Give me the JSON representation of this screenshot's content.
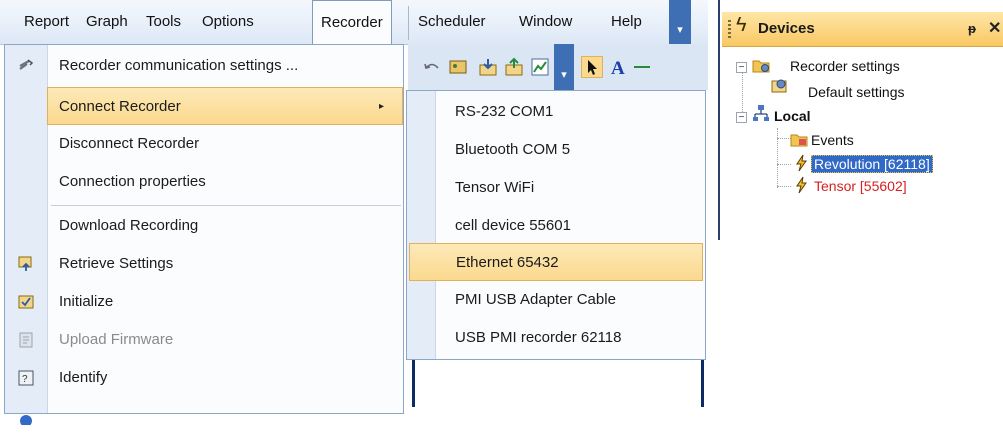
{
  "menubar": {
    "items": [
      "Report",
      "Graph",
      "Tools",
      "Options",
      "Recorder",
      "Scheduler",
      "Window",
      "Help"
    ]
  },
  "recorder_menu": {
    "items": [
      {
        "label": "Recorder communication settings ...",
        "icon": "wrench-icon"
      },
      {
        "label": "Connect Recorder",
        "icon": "",
        "submenu": true,
        "highlighted": true
      },
      {
        "label": "Disconnect Recorder",
        "icon": ""
      },
      {
        "label": "Connection properties",
        "icon": ""
      },
      {
        "label": "Download Recording",
        "icon": ""
      },
      {
        "label": "Retrieve Settings",
        "icon": "retrieve-icon"
      },
      {
        "label": "Initialize",
        "icon": "initialize-icon"
      },
      {
        "label": "Upload Firmware",
        "icon": "upload-icon",
        "disabled": true
      },
      {
        "label": "Identify",
        "icon": "identify-icon"
      }
    ],
    "submenu_arrow": "▸"
  },
  "connect_submenu": {
    "items": [
      "RS-232 COM1",
      "Bluetooth COM 5",
      "Tensor WiFi",
      "cell device 55601",
      "Ethernet 65432",
      "PMI USB Adapter Cable",
      "USB PMI recorder 62118"
    ],
    "highlighted_index": 4
  },
  "devices_panel": {
    "title": "Devices",
    "pin_glyph": "ᵽ",
    "close_glyph": "✕",
    "tree": {
      "recorder_settings": "Recorder settings",
      "default_settings": "Default settings",
      "local": "Local",
      "events": "Events",
      "revolution": "Revolution [62118]",
      "tensor": "Tensor [55602]"
    }
  },
  "colors": {
    "highlight": "#fbd98e",
    "selection": "#3169c6",
    "error_text": "#d82020"
  }
}
